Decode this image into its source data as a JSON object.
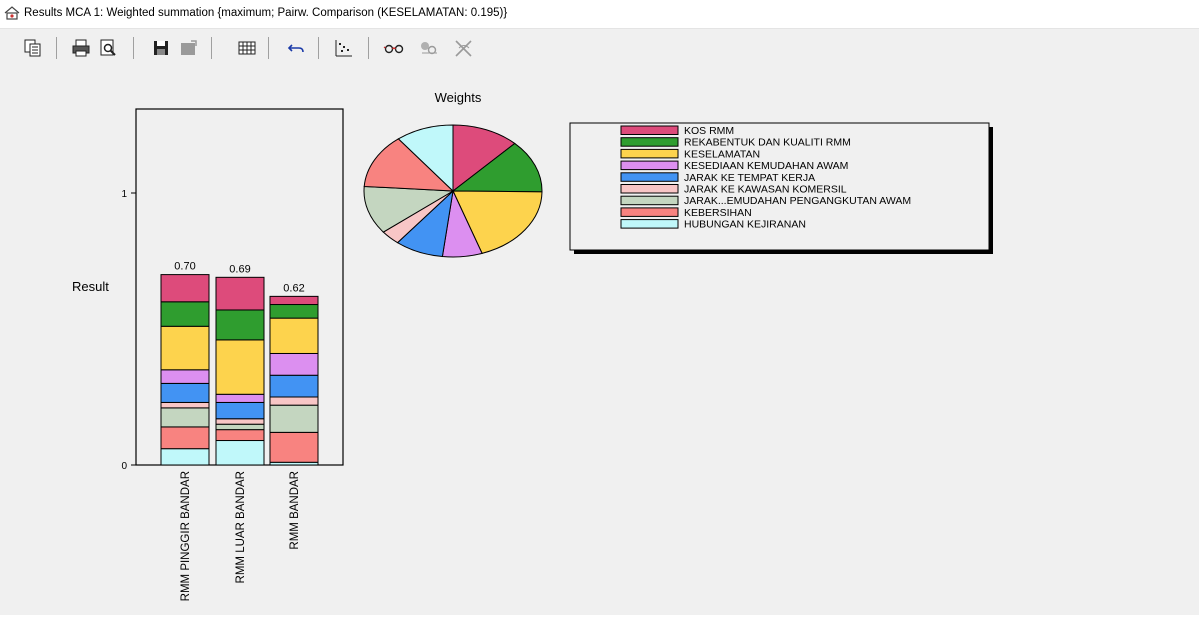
{
  "window": {
    "title": "Results MCA 1: Weighted summation {maximum; Pairw. Comparison (KESELAMATAN: 0.195)}",
    "icon": "app-icon"
  },
  "toolbar": {
    "buttons": [
      {
        "name": "copy-button",
        "icon": "copy-icon",
        "enabled": true
      },
      {
        "name": "print-button",
        "icon": "printer-icon",
        "enabled": true
      },
      {
        "name": "print-preview-button",
        "icon": "print-preview-icon",
        "enabled": true
      },
      {
        "name": "save-button",
        "icon": "floppy-disk-icon",
        "enabled": true
      },
      {
        "name": "save-as-button",
        "icon": "save-as-icon",
        "enabled": false
      },
      {
        "name": "table-button",
        "icon": "table-icon",
        "enabled": true
      },
      {
        "name": "undo-button",
        "icon": "undo-icon",
        "enabled": true
      },
      {
        "name": "scatter-plot-button",
        "icon": "scatter-plot-icon",
        "enabled": true
      },
      {
        "name": "glasses-button",
        "icon": "glasses-icon",
        "enabled": true
      },
      {
        "name": "sensitivity-button",
        "icon": "sensitivity-icon",
        "enabled": false
      },
      {
        "name": "remove-button",
        "icon": "remove-icon",
        "enabled": false
      }
    ]
  },
  "colors": {
    "KOS RMM": "#dd4b7b",
    "REKABENTUK DAN KUALITI RMM": "#2f9d2f",
    "KESELAMATAN": "#fdd34d",
    "KESEDIAAN KEMUDAHAN AWAM": "#dc8ff0",
    "JARAK KE TEMPAT KERJA": "#4293f3",
    "JARAK KE KAWASAN KOMERSIL": "#f8c6c6",
    "JARAK...EMUDAHAN PENGANGKUTAN AWAM": "#c4d6c0",
    "KEBERSIHAN": "#f88380",
    "HUBUNGAN KEJIRANAN": "#c0f8fa"
  },
  "chart_data": [
    {
      "type": "bar",
      "stacked": true,
      "ylabel": "Result",
      "yticks": [
        "0",
        "1"
      ],
      "ylim": [
        0,
        1.3
      ],
      "categories": [
        "RMM PINGGIR BANDAR",
        "RMM LUAR BANDAR",
        "RMM BANDAR"
      ],
      "totals": [
        0.7,
        0.69,
        0.62
      ],
      "total_labels": [
        "0.70",
        "0.69",
        "0.62"
      ],
      "series": [
        {
          "name": "HUBUNGAN KEJIRANAN",
          "values": [
            0.06,
            0.09,
            0.01
          ]
        },
        {
          "name": "KEBERSIHAN",
          "values": [
            0.08,
            0.04,
            0.11
          ]
        },
        {
          "name": "JARAK...EMUDAHAN PENGANGKUTAN AWAM",
          "values": [
            0.07,
            0.02,
            0.1
          ]
        },
        {
          "name": "JARAK KE KAWASAN KOMERSIL",
          "values": [
            0.02,
            0.02,
            0.03
          ]
        },
        {
          "name": "JARAK KE TEMPAT KERJA",
          "values": [
            0.07,
            0.06,
            0.08
          ]
        },
        {
          "name": "KESEDIAAN KEMUDAHAN AWAM",
          "values": [
            0.05,
            0.03,
            0.08
          ]
        },
        {
          "name": "KESELAMATAN",
          "values": [
            0.16,
            0.2,
            0.13
          ]
        },
        {
          "name": "REKABENTUK DAN KUALITI RMM",
          "values": [
            0.09,
            0.11,
            0.05
          ]
        },
        {
          "name": "KOS RMM",
          "values": [
            0.1,
            0.12,
            0.03
          ]
        }
      ]
    },
    {
      "type": "pie",
      "title": "Weights",
      "labels": [
        "KOS RMM",
        "REKABENTUK DAN KUALITI RMM",
        "KESELAMATAN",
        "KESEDIAAN KEMUDAHAN AWAM",
        "JARAK KE TEMPAT KERJA",
        "JARAK KE KAWASAN KOMERSIL",
        "JARAK...EMUDAHAN PENGANGKUTAN AWAM",
        "KEBERSIHAN",
        "HUBUNGAN KEJIRANAN"
      ],
      "values": [
        0.122,
        0.13,
        0.195,
        0.072,
        0.088,
        0.036,
        0.118,
        0.134,
        0.105
      ],
      "legend_position": "right"
    }
  ]
}
